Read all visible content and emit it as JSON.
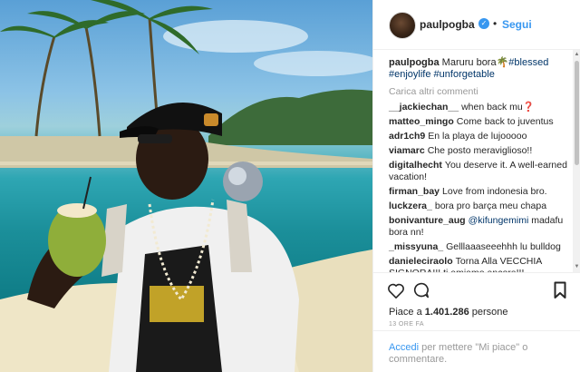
{
  "post": {
    "username": "paulpogba",
    "follow_label": "Segui",
    "dot": "•",
    "verified_glyph": "✓"
  },
  "caption": {
    "user": "paulpogba",
    "text": "Maruru bora",
    "emoji": "🌴",
    "tags": [
      "#blessed",
      "#enjoylife",
      "#unforgetable"
    ]
  },
  "load_more": "Carica altri commenti",
  "comments": [
    {
      "user": "__jackiechan__",
      "text": "when back mu❓"
    },
    {
      "user": "matteo_mingo",
      "text": "Come back to juventus"
    },
    {
      "user": "adr1ch9",
      "text": "En la playa de lujooooo"
    },
    {
      "user": "viamarc",
      "text": "Che posto meraviglioso!!"
    },
    {
      "user": "digitalhecht",
      "text": "You deserve it. A well-earned vacation!"
    },
    {
      "user": "firman_bay",
      "text": "Love from indonesia bro."
    },
    {
      "user": "luckzera_",
      "text": "bora pro barça meu chapa"
    },
    {
      "user": "bonivanture_aug",
      "mention": "@kifungemimi",
      "text": "madafu bora nn!"
    },
    {
      "user": "_missyuna_",
      "text": "Gelllaaaseeehhh lu bulldog"
    },
    {
      "user": "danieleciraolo",
      "text": "Torna Alla VECCHIA SIGNORA!!! ti amiamo ancora!!!"
    }
  ],
  "actions": {
    "likes_prefix": "Piace a",
    "likes_count": "1.401.286",
    "likes_suffix": "persone",
    "time": "13 ORE FA"
  },
  "login": {
    "link": "Accedi",
    "text": "per mettere \"Mi piace\" o commentare."
  },
  "colors": {
    "accent": "#3897f0",
    "text": "#262626",
    "muted": "#999999",
    "hashtag": "#003569"
  }
}
